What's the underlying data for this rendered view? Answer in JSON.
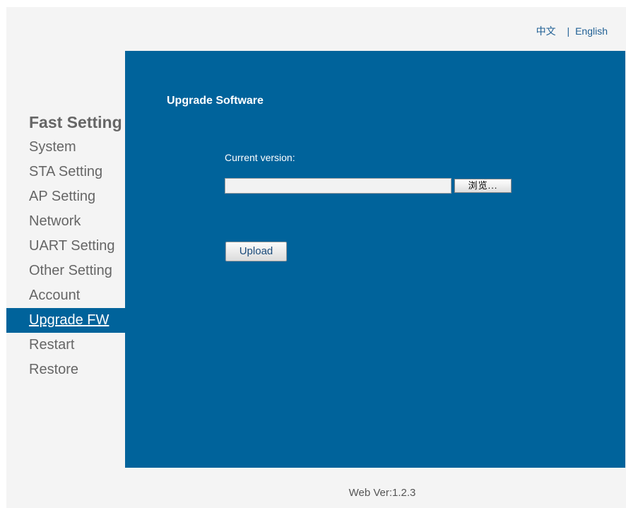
{
  "header": {
    "lang_chinese": "中文",
    "lang_separator": "|",
    "lang_english": "English"
  },
  "sidebar": {
    "title": "Fast Setting",
    "items": [
      {
        "label": "System"
      },
      {
        "label": "STA Setting"
      },
      {
        "label": "AP Setting"
      },
      {
        "label": "Network"
      },
      {
        "label": "UART Setting"
      },
      {
        "label": "Other Setting"
      },
      {
        "label": "Account"
      },
      {
        "label": "Upgrade FW",
        "active": true
      },
      {
        "label": "Restart"
      },
      {
        "label": "Restore"
      }
    ]
  },
  "main": {
    "title": "Upgrade Software",
    "version_label": "Current version:",
    "file_value": "",
    "browse_label": "浏览...",
    "upload_label": "Upload"
  },
  "footer": {
    "web_version": "Web Ver:1.2.3"
  },
  "colors": {
    "accent": "#00639b",
    "page_background": "#f4f4f4",
    "sidebar_text": "#666666",
    "link": "#1f5f94"
  }
}
